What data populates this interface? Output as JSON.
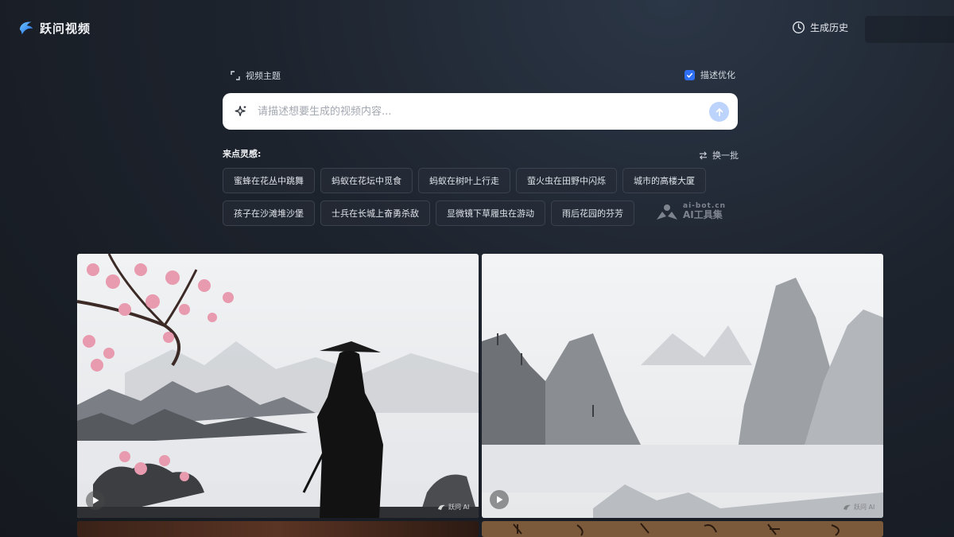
{
  "app": {
    "name": "跃问视频",
    "logo_icon": "dolphin-logo-icon"
  },
  "header": {
    "history_label": "生成历史",
    "history_icon": "clock-icon"
  },
  "prompt": {
    "topic_label": "视频主题",
    "optimize_label": "描述优化",
    "optimize_checked": true,
    "placeholder": "请描述想要生成的视频内容...",
    "value": ""
  },
  "inspiration": {
    "title": "来点灵感:",
    "refresh_label": "换一批",
    "chips_row1": [
      "蜜蜂在花丛中跳舞",
      "蚂蚁在花坛中觅食",
      "蚂蚁在树叶上行走",
      "萤火虫在田野中闪烁",
      "城市的高楼大厦"
    ],
    "chips_row2": [
      "孩子在沙滩堆沙堡",
      "士兵在长城上奋勇杀敌",
      "显微镜下草履虫在游动",
      "雨后花园的芬芳"
    ]
  },
  "watermark": {
    "top": "ai-bot.cn",
    "bottom": "AI工具集"
  },
  "cards": [
    {
      "label": "跃问 AI"
    },
    {
      "label": "跃问 AI"
    }
  ],
  "colors": {
    "accent": "#2f6ff5",
    "send_button": "#bcd3fb",
    "background": "#1d232d"
  }
}
